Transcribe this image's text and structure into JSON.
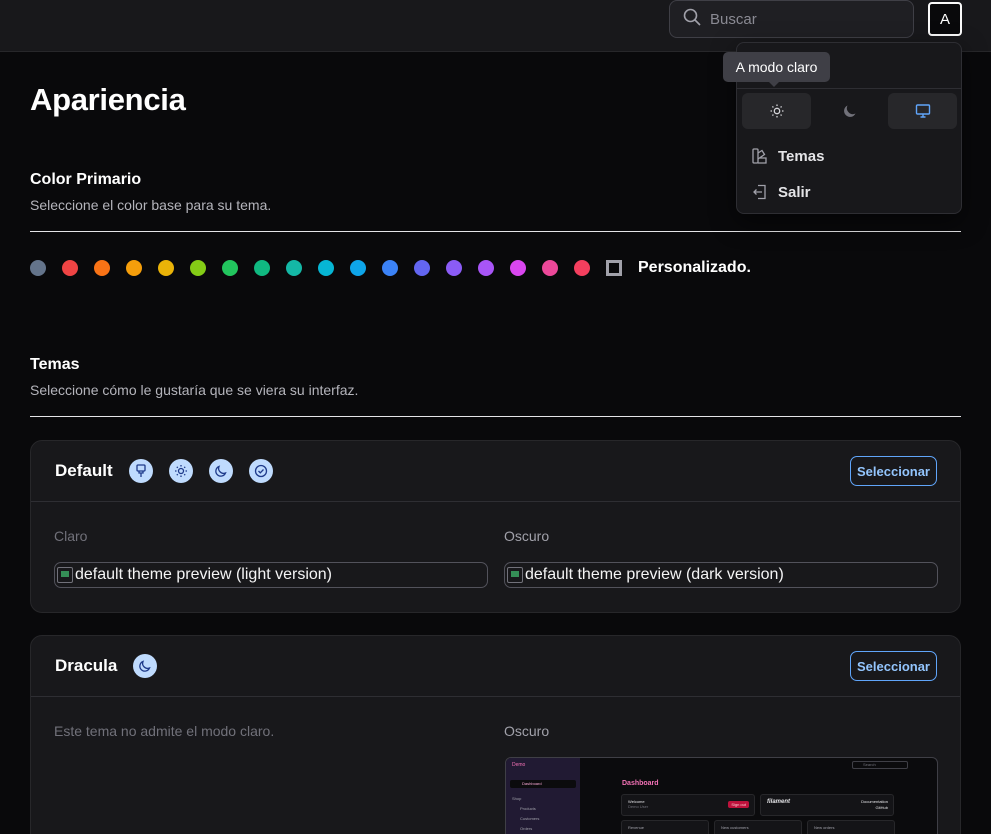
{
  "search": {
    "placeholder": "Buscar"
  },
  "user": {
    "initial": "A"
  },
  "page": {
    "title": "Apariencia"
  },
  "primary_color": {
    "title": "Color Primario",
    "description": "Seleccione el color base para su tema.",
    "colors": [
      "#64748b",
      "#ef4444",
      "#f97316",
      "#f59e0b",
      "#eab308",
      "#84cc16",
      "#22c55e",
      "#10b981",
      "#14b8a6",
      "#06b6d4",
      "#0ea5e9",
      "#3b82f6",
      "#6366f1",
      "#8b5cf6",
      "#a855f7",
      "#d946ef",
      "#ec4899",
      "#f43f5e"
    ],
    "custom_label": "Personalizado."
  },
  "themes": {
    "title": "Temas",
    "description": "Seleccione cómo le gustaría que se viera su interfaz.",
    "default": {
      "name": "Default",
      "select_label": "Seleccionar",
      "light_label": "Claro",
      "dark_label": "Oscuro",
      "light_alt": "default theme preview (light version)",
      "dark_alt": "default theme preview (dark version)"
    },
    "dracula": {
      "name": "Dracula",
      "select_label": "Seleccionar",
      "no_light": "Este tema no admite el modo claro.",
      "dark_label": "Oscuro",
      "preview": {
        "brand": "Demo",
        "nav_selected": "Dashboard",
        "nav_group": "Shop",
        "nav_items": [
          "Products",
          "Customers",
          "Orders"
        ],
        "heading": "Dashboard",
        "search": "Search",
        "welcome": "Welcome",
        "welcome_sub": "Demo User",
        "sign_out": "Sign out",
        "filament": "filament",
        "documentation": "Documentation",
        "github": "GitHub",
        "revenue": "Revenue",
        "new_customers": "New customers",
        "new_orders": "New orders"
      }
    }
  },
  "user_menu": {
    "tooltip": "A modo claro",
    "items": [
      {
        "label": "Temas",
        "icon": "swatch-icon"
      },
      {
        "label": "Salir",
        "icon": "logout-icon"
      }
    ]
  }
}
